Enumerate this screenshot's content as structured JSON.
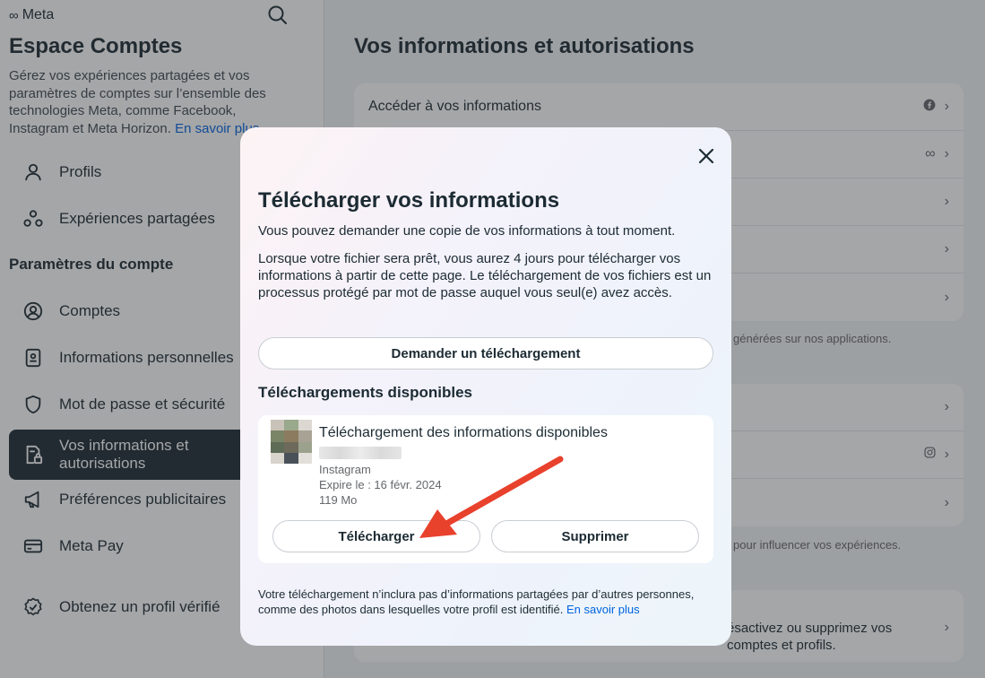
{
  "sidebar": {
    "logo": "Meta",
    "title": "Espace Comptes",
    "description": "Gérez vos expériences partagées et vos paramètres de comptes sur l’ensemble des technologies Meta, comme Facebook, Instagram et Meta Horizon.",
    "learn_more": "En savoir plus",
    "items_top": [
      {
        "label": "Profils",
        "icon": "person-icon"
      },
      {
        "label": "Expériences partagées",
        "icon": "shared-experiences-icon"
      }
    ],
    "section": "Paramètres du compte",
    "items_settings": [
      {
        "label": "Comptes",
        "icon": "account-circle-icon"
      },
      {
        "label": "Informations personnelles",
        "icon": "id-card-icon"
      },
      {
        "label": "Mot de passe et sécurité",
        "icon": "shield-icon"
      },
      {
        "label": "Vos informations et autorisations",
        "icon": "document-lock-icon"
      },
      {
        "label": "Préférences publicitaires",
        "icon": "megaphone-icon"
      },
      {
        "label": "Meta Pay",
        "icon": "credit-card-icon"
      }
    ],
    "verified": {
      "label": "Obtenez un profil vérifié",
      "icon": "verified-badge-icon"
    }
  },
  "main": {
    "title": "Vos informations et autorisations",
    "card1_first_row": "Accéder à vos informations",
    "note1": "générées sur nos applications.",
    "note2": "pour influencer vos expériences.",
    "card3_row_a": "ésactivez ou supprimez vos",
    "card3_row_b": "comptes et profils."
  },
  "modal": {
    "title": "Télécharger vos informations",
    "p1": "Vous pouvez demander une copie de vos informations à tout moment.",
    "p2": "Lorsque votre fichier sera prêt, vous aurez 4 jours pour télécharger vos informations à partir de cette page. Le téléchargement de vos fichiers est un processus protégé par mot de passe auquel vous seul(e) avez accès.",
    "request_button": "Demander un téléchargement",
    "available_heading": "Téléchargements disponibles",
    "download": {
      "title": "Téléchargement des informations disponibles",
      "source": "Instagram",
      "expires": "Expire le : 16 févr. 2024",
      "size": "119 Mo",
      "download_button": "Télécharger",
      "delete_button": "Supprimer"
    },
    "footer": "Votre téléchargement n’inclura pas d’informations partagées par d’autres personnes, comme des photos dans lesquelles votre profil est identifié.",
    "footer_link": "En savoir plus"
  },
  "colors": {
    "accent": "#0064e0",
    "arrow": "#e8412c",
    "active_nav": "#1c2b33"
  }
}
